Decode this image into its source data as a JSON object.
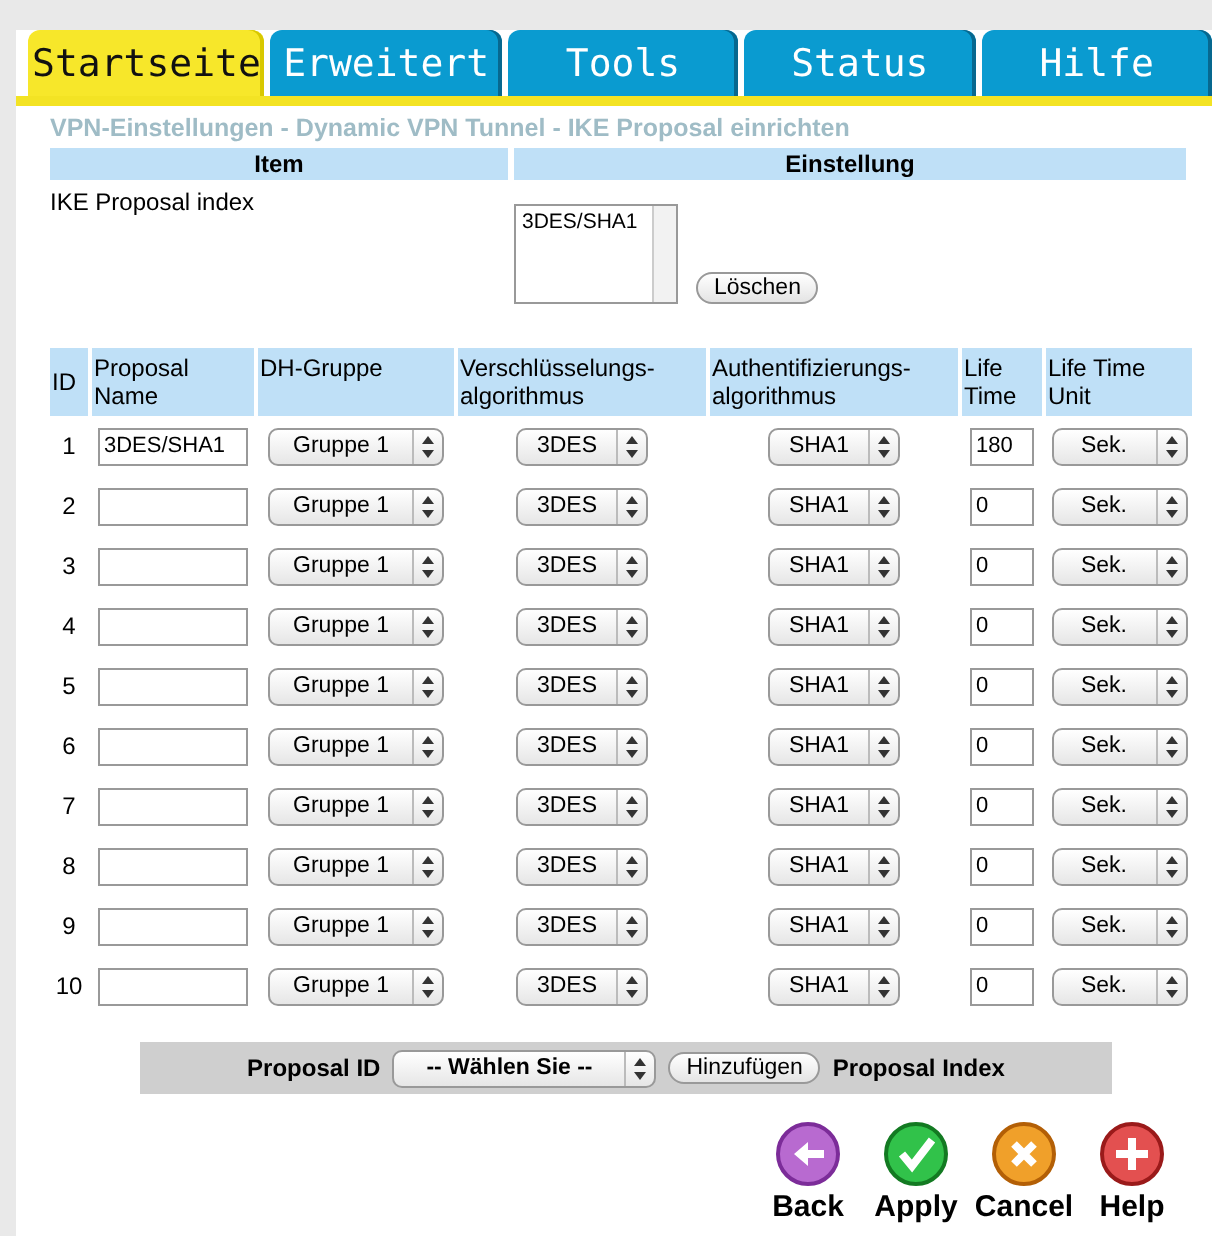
{
  "tabs": [
    {
      "label": "Startseite",
      "selected": true
    },
    {
      "label": "Erweitert",
      "selected": false
    },
    {
      "label": "Tools",
      "selected": false
    },
    {
      "label": "Status",
      "selected": false
    },
    {
      "label": "Hilfe",
      "selected": false
    }
  ],
  "page_title": "VPN-Einstellungen - Dynamic VPN Tunnel - IKE Proposal einrichten",
  "settings_table": {
    "columns": [
      "Item",
      "Einstellung"
    ],
    "label": "IKE Proposal index",
    "listbox": [
      "3DES/SHA1"
    ],
    "delete_button": "Löschen"
  },
  "proposal_table": {
    "columns": [
      "ID",
      "Proposal Name",
      "DH-Gruppe",
      "Verschlüsselungs-algorithmus",
      "Authentifizierungs-algorithmus",
      "Life Time",
      "Life Time Unit"
    ],
    "rows": [
      {
        "id": "1",
        "name": "3DES/SHA1",
        "dh": "Gruppe 1",
        "enc": "3DES",
        "auth": "SHA1",
        "life_time": "180",
        "unit": "Sek."
      },
      {
        "id": "2",
        "name": "",
        "dh": "Gruppe 1",
        "enc": "3DES",
        "auth": "SHA1",
        "life_time": "0",
        "unit": "Sek."
      },
      {
        "id": "3",
        "name": "",
        "dh": "Gruppe 1",
        "enc": "3DES",
        "auth": "SHA1",
        "life_time": "0",
        "unit": "Sek."
      },
      {
        "id": "4",
        "name": "",
        "dh": "Gruppe 1",
        "enc": "3DES",
        "auth": "SHA1",
        "life_time": "0",
        "unit": "Sek."
      },
      {
        "id": "5",
        "name": "",
        "dh": "Gruppe 1",
        "enc": "3DES",
        "auth": "SHA1",
        "life_time": "0",
        "unit": "Sek."
      },
      {
        "id": "6",
        "name": "",
        "dh": "Gruppe 1",
        "enc": "3DES",
        "auth": "SHA1",
        "life_time": "0",
        "unit": "Sek."
      },
      {
        "id": "7",
        "name": "",
        "dh": "Gruppe 1",
        "enc": "3DES",
        "auth": "SHA1",
        "life_time": "0",
        "unit": "Sek."
      },
      {
        "id": "8",
        "name": "",
        "dh": "Gruppe 1",
        "enc": "3DES",
        "auth": "SHA1",
        "life_time": "0",
        "unit": "Sek."
      },
      {
        "id": "9",
        "name": "",
        "dh": "Gruppe 1",
        "enc": "3DES",
        "auth": "SHA1",
        "life_time": "0",
        "unit": "Sek."
      },
      {
        "id": "10",
        "name": "",
        "dh": "Gruppe 1",
        "enc": "3DES",
        "auth": "SHA1",
        "life_time": "0",
        "unit": "Sek."
      }
    ]
  },
  "add_bar": {
    "label": "Proposal ID",
    "select": "-- Wählen Sie --",
    "button": "Hinzufügen",
    "suffix": "Proposal Index"
  },
  "actions": [
    {
      "kind": "back",
      "label": "Back"
    },
    {
      "kind": "apply",
      "label": "Apply"
    },
    {
      "kind": "cancel",
      "label": "Cancel"
    },
    {
      "kind": "help",
      "label": "Help"
    }
  ]
}
